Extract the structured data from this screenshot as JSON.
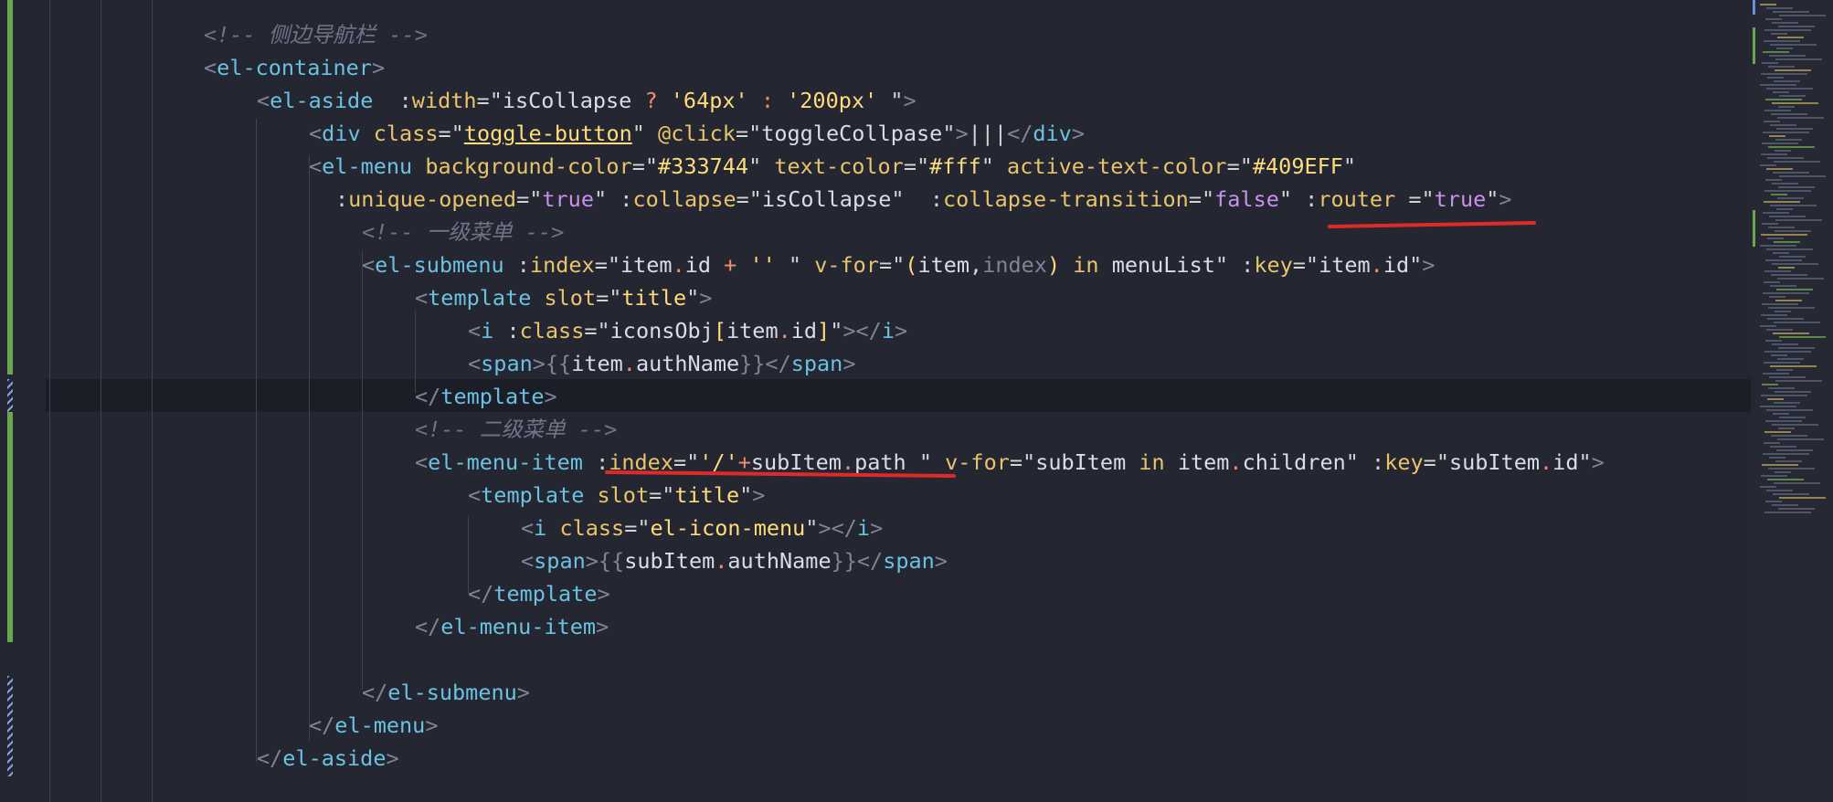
{
  "lines": [
    [
      {
        "t": "<!-- 侧边导航栏 -->",
        "c": "c"
      }
    ],
    [
      {
        "t": "<",
        "c": "b"
      },
      {
        "t": "el-container",
        "c": "t"
      },
      {
        "t": ">",
        "c": "b"
      }
    ],
    [
      {
        "t": "<",
        "c": "b"
      },
      {
        "t": "el-aside",
        "c": "t"
      },
      {
        "t": "  :",
        "c": "p"
      },
      {
        "t": "width",
        "c": "a"
      },
      {
        "t": "=\"",
        "c": "p"
      },
      {
        "t": "isCollapse",
        "c": "s"
      },
      {
        "t": " ? ",
        "c": "o"
      },
      {
        "t": "'64px'",
        "c": "q"
      },
      {
        "t": " : ",
        "c": "o"
      },
      {
        "t": "'200px'",
        "c": "q"
      },
      {
        "t": " \"",
        "c": "p"
      },
      {
        "t": ">",
        "c": "b"
      }
    ],
    [
      {
        "t": "<",
        "c": "b"
      },
      {
        "t": "div",
        "c": "t"
      },
      {
        "t": " ",
        "c": "p"
      },
      {
        "t": "class",
        "c": "a"
      },
      {
        "t": "=\"",
        "c": "p"
      },
      {
        "t": "toggle-button",
        "c": "q u"
      },
      {
        "t": "\" ",
        "c": "p"
      },
      {
        "t": "@click",
        "c": "a"
      },
      {
        "t": "=\"",
        "c": "p"
      },
      {
        "t": "toggleCollpase",
        "c": "s"
      },
      {
        "t": "\"",
        "c": "p"
      },
      {
        "t": ">",
        "c": "b"
      },
      {
        "t": "|||",
        "c": "p"
      },
      {
        "t": "</",
        "c": "b"
      },
      {
        "t": "div",
        "c": "t"
      },
      {
        "t": ">",
        "c": "b"
      }
    ],
    [
      {
        "t": "<",
        "c": "b"
      },
      {
        "t": "el-menu",
        "c": "t"
      },
      {
        "t": " ",
        "c": "p"
      },
      {
        "t": "background-color",
        "c": "a"
      },
      {
        "t": "=\"",
        "c": "p"
      },
      {
        "t": "#333744",
        "c": "q"
      },
      {
        "t": "\" ",
        "c": "p"
      },
      {
        "t": "text-color",
        "c": "a"
      },
      {
        "t": "=\"",
        "c": "p"
      },
      {
        "t": "#fff",
        "c": "q"
      },
      {
        "t": "\" ",
        "c": "p"
      },
      {
        "t": "active-text-color",
        "c": "a"
      },
      {
        "t": "=\"",
        "c": "p"
      },
      {
        "t": "#409EFF",
        "c": "q"
      },
      {
        "t": "\"",
        "c": "p"
      }
    ],
    [
      {
        "t": ":",
        "c": "p"
      },
      {
        "t": "unique-opened",
        "c": "a"
      },
      {
        "t": "=\"",
        "c": "p"
      },
      {
        "t": "true",
        "c": "k"
      },
      {
        "t": "\" :",
        "c": "p"
      },
      {
        "t": "collapse",
        "c": "a"
      },
      {
        "t": "=\"",
        "c": "p"
      },
      {
        "t": "isCollapse",
        "c": "s"
      },
      {
        "t": "\"  :",
        "c": "p"
      },
      {
        "t": "collapse-transition",
        "c": "a"
      },
      {
        "t": "=\"",
        "c": "p"
      },
      {
        "t": "false",
        "c": "k"
      },
      {
        "t": "\" :",
        "c": "p"
      },
      {
        "t": "router",
        "c": "a"
      },
      {
        "t": " =\"",
        "c": "p"
      },
      {
        "t": "true",
        "c": "k"
      },
      {
        "t": "\"",
        "c": "p"
      },
      {
        "t": ">",
        "c": "b"
      }
    ],
    [
      {
        "t": "<!-- 一级菜单 -->",
        "c": "c"
      }
    ],
    [
      {
        "t": "<",
        "c": "b"
      },
      {
        "t": "el-submenu",
        "c": "t"
      },
      {
        "t": " :",
        "c": "p"
      },
      {
        "t": "index",
        "c": "a"
      },
      {
        "t": "=\"",
        "c": "p"
      },
      {
        "t": "item",
        "c": "s"
      },
      {
        "t": ".",
        "c": "o"
      },
      {
        "t": "id",
        "c": "s"
      },
      {
        "t": " + ",
        "c": "o"
      },
      {
        "t": "''",
        "c": "q"
      },
      {
        "t": " \" ",
        "c": "p"
      },
      {
        "t": "v-for",
        "c": "a"
      },
      {
        "t": "=\"",
        "c": "p"
      },
      {
        "t": "(",
        "c": "q"
      },
      {
        "t": "item",
        "c": "s"
      },
      {
        "t": ",",
        "c": "p"
      },
      {
        "t": "index",
        "c": "b"
      },
      {
        "t": ")",
        "c": "q"
      },
      {
        "t": " in ",
        "c": "a"
      },
      {
        "t": "menuList",
        "c": "s"
      },
      {
        "t": "\" :",
        "c": "p"
      },
      {
        "t": "key",
        "c": "a"
      },
      {
        "t": "=\"",
        "c": "p"
      },
      {
        "t": "item",
        "c": "s"
      },
      {
        "t": ".",
        "c": "o"
      },
      {
        "t": "id",
        "c": "s"
      },
      {
        "t": "\"",
        "c": "p"
      },
      {
        "t": ">",
        "c": "b"
      }
    ],
    [
      {
        "t": "<",
        "c": "b"
      },
      {
        "t": "template",
        "c": "t"
      },
      {
        "t": " ",
        "c": "p"
      },
      {
        "t": "slot",
        "c": "a"
      },
      {
        "t": "=\"",
        "c": "p"
      },
      {
        "t": "title",
        "c": "q"
      },
      {
        "t": "\"",
        "c": "p"
      },
      {
        "t": ">",
        "c": "b"
      }
    ],
    [
      {
        "t": "<",
        "c": "b"
      },
      {
        "t": "i",
        "c": "t"
      },
      {
        "t": " :",
        "c": "p"
      },
      {
        "t": "class",
        "c": "a"
      },
      {
        "t": "=\"",
        "c": "p"
      },
      {
        "t": "iconsObj",
        "c": "s"
      },
      {
        "t": "[",
        "c": "q"
      },
      {
        "t": "item",
        "c": "s"
      },
      {
        "t": ".",
        "c": "o"
      },
      {
        "t": "id",
        "c": "s"
      },
      {
        "t": "]",
        "c": "q"
      },
      {
        "t": "\"",
        "c": "p"
      },
      {
        "t": "></",
        "c": "b"
      },
      {
        "t": "i",
        "c": "t"
      },
      {
        "t": ">",
        "c": "b"
      }
    ],
    [
      {
        "t": "<",
        "c": "b"
      },
      {
        "t": "span",
        "c": "t"
      },
      {
        "t": ">{{",
        "c": "b"
      },
      {
        "t": "item",
        "c": "s"
      },
      {
        "t": ".",
        "c": "o"
      },
      {
        "t": "authName",
        "c": "s"
      },
      {
        "t": "}}</",
        "c": "b"
      },
      {
        "t": "span",
        "c": "t"
      },
      {
        "t": ">",
        "c": "b"
      }
    ],
    [
      {
        "t": "</",
        "c": "b"
      },
      {
        "t": "template",
        "c": "t"
      },
      {
        "t": ">",
        "c": "b"
      }
    ],
    [
      {
        "t": "<!-- 二级菜单 -->",
        "c": "c"
      }
    ],
    [
      {
        "t": "<",
        "c": "b"
      },
      {
        "t": "el-menu-item",
        "c": "t"
      },
      {
        "t": " :",
        "c": "p"
      },
      {
        "t": "index",
        "c": "a"
      },
      {
        "t": "=\"",
        "c": "p"
      },
      {
        "t": "'/'",
        "c": "q"
      },
      {
        "t": "+",
        "c": "o"
      },
      {
        "t": "subItem",
        "c": "s"
      },
      {
        "t": ".",
        "c": "o"
      },
      {
        "t": "path",
        "c": "s"
      },
      {
        "t": " \" ",
        "c": "p"
      },
      {
        "t": "v-for",
        "c": "a"
      },
      {
        "t": "=\"",
        "c": "p"
      },
      {
        "t": "subItem",
        "c": "s"
      },
      {
        "t": " in ",
        "c": "a"
      },
      {
        "t": "item",
        "c": "s"
      },
      {
        "t": ".",
        "c": "o"
      },
      {
        "t": "children",
        "c": "s"
      },
      {
        "t": "\" :",
        "c": "p"
      },
      {
        "t": "key",
        "c": "a"
      },
      {
        "t": "=\"",
        "c": "p"
      },
      {
        "t": "subItem",
        "c": "s"
      },
      {
        "t": ".",
        "c": "o"
      },
      {
        "t": "id",
        "c": "s"
      },
      {
        "t": "\"",
        "c": "p"
      },
      {
        "t": ">",
        "c": "b"
      }
    ],
    [
      {
        "t": "<",
        "c": "b"
      },
      {
        "t": "template",
        "c": "t"
      },
      {
        "t": " ",
        "c": "p"
      },
      {
        "t": "slot",
        "c": "a"
      },
      {
        "t": "=\"",
        "c": "p"
      },
      {
        "t": "title",
        "c": "q"
      },
      {
        "t": "\"",
        "c": "p"
      },
      {
        "t": ">",
        "c": "b"
      }
    ],
    [
      {
        "t": "<",
        "c": "b"
      },
      {
        "t": "i",
        "c": "t"
      },
      {
        "t": " ",
        "c": "p"
      },
      {
        "t": "class",
        "c": "a"
      },
      {
        "t": "=\"",
        "c": "p"
      },
      {
        "t": "el-icon-menu",
        "c": "q"
      },
      {
        "t": "\"",
        "c": "p"
      },
      {
        "t": "></",
        "c": "b"
      },
      {
        "t": "i",
        "c": "t"
      },
      {
        "t": ">",
        "c": "b"
      }
    ],
    [
      {
        "t": "<",
        "c": "b"
      },
      {
        "t": "span",
        "c": "t"
      },
      {
        "t": ">{{",
        "c": "b"
      },
      {
        "t": "subItem",
        "c": "s"
      },
      {
        "t": ".",
        "c": "o"
      },
      {
        "t": "authName",
        "c": "s"
      },
      {
        "t": "}}</",
        "c": "b"
      },
      {
        "t": "span",
        "c": "t"
      },
      {
        "t": ">",
        "c": "b"
      }
    ],
    [
      {
        "t": "</",
        "c": "b"
      },
      {
        "t": "template",
        "c": "t"
      },
      {
        "t": ">",
        "c": "b"
      }
    ],
    [
      {
        "t": "</",
        "c": "b"
      },
      {
        "t": "el-menu-item",
        "c": "t"
      },
      {
        "t": ">",
        "c": "b"
      }
    ],
    [],
    [
      {
        "t": "</",
        "c": "b"
      },
      {
        "t": "el-submenu",
        "c": "t"
      },
      {
        "t": ">",
        "c": "b"
      }
    ],
    [
      {
        "t": "</",
        "c": "b"
      },
      {
        "t": "el-menu",
        "c": "t"
      },
      {
        "t": ">",
        "c": "b"
      }
    ],
    [
      {
        "t": "</",
        "c": "b"
      },
      {
        "t": "el-aside",
        "c": "t"
      },
      {
        "t": ">",
        "c": "b"
      }
    ]
  ],
  "colors": {
    "background": "#242632",
    "annotation": "#e02a2a"
  }
}
